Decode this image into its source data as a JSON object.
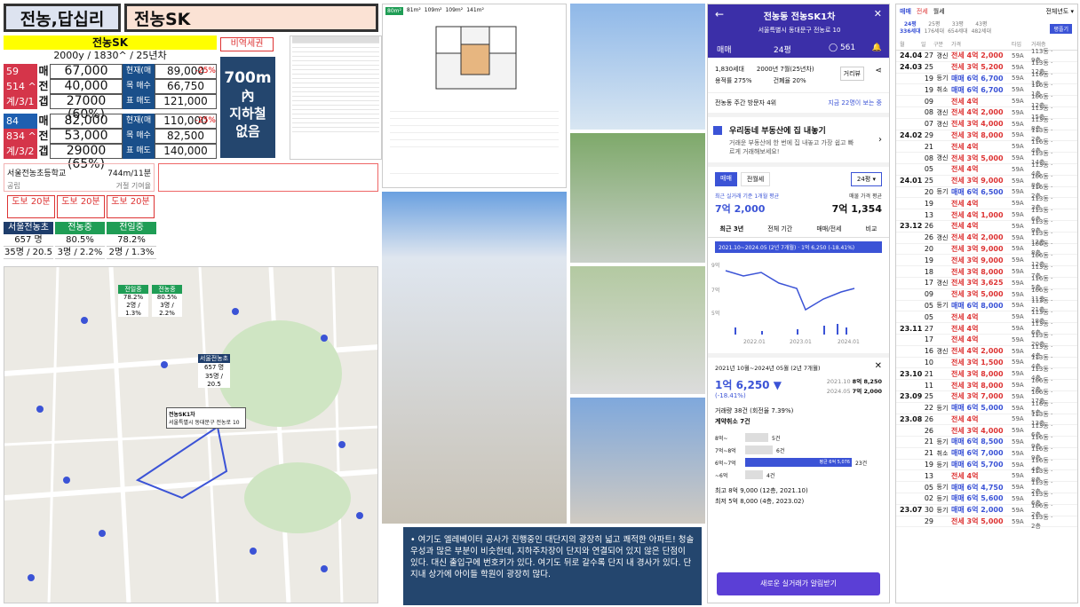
{
  "header": {
    "area": "전농,답십리",
    "complex": "전농SK"
  },
  "price_table": {
    "title": "전농SK",
    "subtitle": "2000y / 1830^ / 25년차",
    "rows": [
      {
        "size": "59 m2",
        "type": "매",
        "value": "67,000",
        "label": "현재(매매)",
        "label_val": "89,000",
        "pct": "-25%",
        "bg": "#d5354a"
      },
      {
        "size": "514 ^",
        "type": "전",
        "value": "40,000",
        "label": "목  매수",
        "label_val": "66,750",
        "pct": "",
        "bg": "#d5354a"
      },
      {
        "size": "계/3/1",
        "type": "갭",
        "value": "27000 (60%)",
        "label": "표  매도",
        "label_val": "121,000",
        "pct": "",
        "bg": "#d5354a"
      },
      {
        "size": "84 m2",
        "type": "매",
        "value": "82,000",
        "label": "현재(매매)",
        "label_val": "110,000",
        "pct": "-25%",
        "bg": "#1e5fb0"
      },
      {
        "size": "834 ^",
        "type": "전",
        "value": "53,000",
        "label": "목  매수",
        "label_val": "82,500",
        "pct": "",
        "bg": "#d5354a"
      },
      {
        "size": "계/3/2",
        "type": "갭",
        "value": "29000 (65%)",
        "label": "표  매도",
        "label_val": "140,000",
        "pct": "",
        "bg": "#d5354a"
      }
    ]
  },
  "hazard": "비역세권",
  "subway": {
    "l1": "700m",
    "l2": "內",
    "l3": "지하철",
    "l4": "없음"
  },
  "school": {
    "name": "서울전농초등학교",
    "dist": "744m/11분",
    "type": "공립",
    "note": "거절 기여율"
  },
  "walk": [
    "도보 20분",
    "도보 20분",
    "도보 20분"
  ],
  "schools": [
    {
      "name": "서울전농초",
      "v1": "657 명",
      "v2": "35명 / 20.5",
      "color": "#1e3d6b"
    },
    {
      "name": "전농중",
      "v1": "80.5%",
      "v2": "3명 / 2.2%",
      "color": "#1f9d55"
    },
    {
      "name": "전일중",
      "v1": "78.2%",
      "v2": "2명 / 1.3%",
      "color": "#1f9d55"
    }
  ],
  "map": {
    "labels": [
      {
        "t": "전일중",
        "s": "78.2%",
        "u": "2명 / 1.3%"
      },
      {
        "t": "전농중",
        "s": "80.5%",
        "u": "3명 / 2.2%"
      },
      {
        "t": "서울전농초",
        "s": "657 명",
        "u": "35명 / 20.5"
      }
    ],
    "tag": "전농SK1차",
    "tag2": "서울특별시 동대문구 전농로 10"
  },
  "floorplan": {
    "tabs": [
      "80m²",
      "81m²",
      "109m²",
      "109m²",
      "141m²"
    ]
  },
  "description": "여기도 엘레베이터 공사가 진행중인 대단지의 광장히 넓고 쾌적한 아파트! 청솔우성과 많은 부분이 비슷한데, 지하주차장이 단지와 연결되어 있지 않은 단점이 있다. 대신 출입구에 번호키가 있다. 여기도 뒤로 갈수록 단지 내 경사가 있다. 단지내 상가에 아이들 학원이 광장히 많다.",
  "app": {
    "title": "전농동 전농SK1차",
    "address": "서울특별시 동대문구 전농로 10",
    "tab_type": "매매",
    "pyeong": "24평",
    "comments": "561",
    "units": "1,830세대",
    "built": "2000년 7월(25년차)",
    "far": "용적률 275%",
    "bcr": "건폐율 20%",
    "street_btn": "거리뷰",
    "visitors": "전농동 주간 방문자 4위",
    "visitors_link": "지금 22명이 보는 중",
    "promo_title": "우리동네 부동산에 집 내놓기",
    "promo_body": "거래운 부동산에 한 번에 집 내놓고 가장 쉽고 빠르게 거래해보세요!",
    "tab1": "매매",
    "tab2": "전월세",
    "size_sel": "24평",
    "recent_label": "최근 실거래 기준 1개월 평균",
    "recent_price": "7억 2,000",
    "ask_label": "매물 가격 평균",
    "ask_price": "7억 1,354",
    "period_tabs": [
      "최근 3년",
      "전체 기간",
      "매매/전세",
      "비교"
    ],
    "chart_banner": "2021.10~2024.05 (2년 7개월) · 1억 6,250 (-18.41%)",
    "chart_xlabels": [
      "2022.01",
      "2023.01",
      "2024.01"
    ],
    "chart_ylabels": [
      "9억",
      "7억",
      "5억"
    ],
    "drop_header": "2021년 10월~2024년 05월 (2년 7개월)",
    "drop_value": "1억 6,250 ▼",
    "drop_pct": "(-18.41%)",
    "drop_from": "2021.10",
    "drop_from_val": "8억 8,250",
    "drop_to": "2024.05",
    "drop_to_val": "7억 2,000",
    "deals": "거래량 38건 (회전율 7.39%)",
    "cancel": "계약취소 7건",
    "hist": [
      {
        "r": "8억~",
        "n": "5건",
        "w": 0.22
      },
      {
        "r": "7억~8억",
        "n": "6건",
        "w": 0.26
      },
      {
        "r": "6억~7억",
        "n": "23건",
        "w": 1.0,
        "tag": "평균 6억 5,076"
      },
      {
        "r": "~6억",
        "n": "4건",
        "w": 0.17
      }
    ],
    "high": "최고 8억 9,000 (12층, 2021.10)",
    "low": "최저 5억 8,000 (4층, 2023.02)",
    "alarm": "새로운 실거래가 알림받기"
  },
  "right_list": {
    "tabs": [
      "매매",
      "전세",
      "월세"
    ],
    "filter": "전체년도",
    "counts": [
      [
        "24평",
        "336세대"
      ],
      [
        "25평",
        "176세대"
      ],
      [
        "33평",
        "654세대"
      ],
      [
        "43평",
        "482세대"
      ]
    ],
    "btn": "평플기",
    "cols": [
      "월",
      "일",
      "구분",
      "가격",
      "타입",
      "거래층"
    ],
    "rows": [
      [
        "24.04",
        "27",
        "갱신",
        "전세 4억 2,000",
        "59A",
        "113동 · 9층"
      ],
      [
        "24.03",
        "25",
        "",
        "전세 3억 5,200",
        "59A",
        "113동 · 12층"
      ],
      [
        "",
        "19",
        "등기",
        "매매 6억 6,700",
        "59A",
        "116동 · 1층"
      ],
      [
        "",
        "19",
        "취소",
        "매매 6억 6,700",
        "59A",
        "116동 · 1층"
      ],
      [
        "",
        "09",
        "",
        "전세 4억",
        "59A",
        "106동 · 12층"
      ],
      [
        "",
        "08",
        "갱신",
        "전세 4억 2,000",
        "59A",
        "113동 · 15층"
      ],
      [
        "",
        "07",
        "갱신",
        "전세 3억 4,000",
        "59A",
        "113동 · 8층"
      ],
      [
        "24.02",
        "29",
        "",
        "전세 3억 8,000",
        "59A",
        "113동 · 2층"
      ],
      [
        "",
        "21",
        "",
        "전세 4억",
        "59A",
        "116동 · 4층"
      ],
      [
        "",
        "08",
        "갱신",
        "전세 3억 5,000",
        "59A",
        "113동 · 14층"
      ],
      [
        "",
        "05",
        "",
        "전세 4억",
        "59A",
        "113동 · 4층"
      ],
      [
        "24.01",
        "25",
        "",
        "전세 3억 9,000",
        "59A",
        "106동 · 8층"
      ],
      [
        "",
        "20",
        "등기",
        "매매 6억 6,500",
        "59A",
        "116동 · 2층"
      ],
      [
        "",
        "19",
        "",
        "전세 4억",
        "59A",
        "113동 · 3층"
      ],
      [
        "",
        "13",
        "",
        "전세 4억 1,000",
        "59A",
        "113동 · 6층"
      ],
      [
        "23.12",
        "26",
        "",
        "전세 4억",
        "59A",
        "113동 · 9층"
      ],
      [
        "",
        "26",
        "갱신",
        "전세 4억 2,000",
        "59A",
        "113동 · 12층"
      ],
      [
        "",
        "20",
        "",
        "전세 3억 9,000",
        "59A",
        "106동 · 8층"
      ],
      [
        "",
        "19",
        "",
        "전세 3억 9,000",
        "59A",
        "106동 · 12층"
      ],
      [
        "",
        "18",
        "",
        "전세 3억 8,000",
        "59A",
        "113동 · 7층"
      ],
      [
        "",
        "17",
        "갱신",
        "전세 3억 3,625",
        "59A",
        "116동 · 5층"
      ],
      [
        "",
        "09",
        "",
        "전세 3억 5,000",
        "59A",
        "106동 · 11층"
      ],
      [
        "",
        "05",
        "등기",
        "매매 6억 8,000",
        "59A",
        "113동 · 21층"
      ],
      [
        "",
        "05",
        "",
        "전세 4억",
        "59A",
        "113동 · 18층"
      ],
      [
        "23.11",
        "27",
        "",
        "전세 4억",
        "59A",
        "113동 · 6층"
      ],
      [
        "",
        "17",
        "",
        "전세 4억",
        "59A",
        "113동 · 20층"
      ],
      [
        "",
        "16",
        "갱신",
        "전세 4억 2,000",
        "59A",
        "113동 · 4층"
      ],
      [
        "",
        "10",
        "",
        "전세 3억 1,500",
        "59A",
        "113동 · 4층"
      ],
      [
        "23.10",
        "21",
        "",
        "전세 3억 8,000",
        "59A",
        "113동 · 4층"
      ],
      [
        "",
        "11",
        "",
        "전세 3억 8,000",
        "59A",
        "106동 · 2층"
      ],
      [
        "23.09",
        "25",
        "",
        "전세 3억 7,000",
        "59A",
        "106동 · 17층"
      ],
      [
        "",
        "22",
        "등기",
        "매매 6억 5,000",
        "59A",
        "116동 · 5층"
      ],
      [
        "23.08",
        "26",
        "",
        "전세 4억",
        "59A",
        "113동 · 13층"
      ],
      [
        "",
        "26",
        "",
        "전세 3억 4,000",
        "59A",
        "113동 · 6층"
      ],
      [
        "",
        "21",
        "등기",
        "매매 6억 8,500",
        "59A",
        "116동 · 9층"
      ],
      [
        "",
        "21",
        "취소",
        "매매 6억 7,000",
        "59A",
        "116동 · 9층"
      ],
      [
        "",
        "19",
        "등기",
        "매매 6억 5,700",
        "59A",
        "116동 · 4층"
      ],
      [
        "",
        "13",
        "",
        "전세 4억",
        "59A",
        "113동 · 8층"
      ],
      [
        "",
        "05",
        "등기",
        "매매 6억 4,750",
        "59A",
        "113동 · 2층"
      ],
      [
        "",
        "02",
        "등기",
        "매매 6억 5,600",
        "59A",
        "113동 · 6층"
      ],
      [
        "23.07",
        "30",
        "등기",
        "매매 6억 2,000",
        "59A",
        "106동 · 2층"
      ],
      [
        "",
        "29",
        "",
        "전세 3억 5,000",
        "59A",
        "113동 · 2층"
      ]
    ]
  }
}
